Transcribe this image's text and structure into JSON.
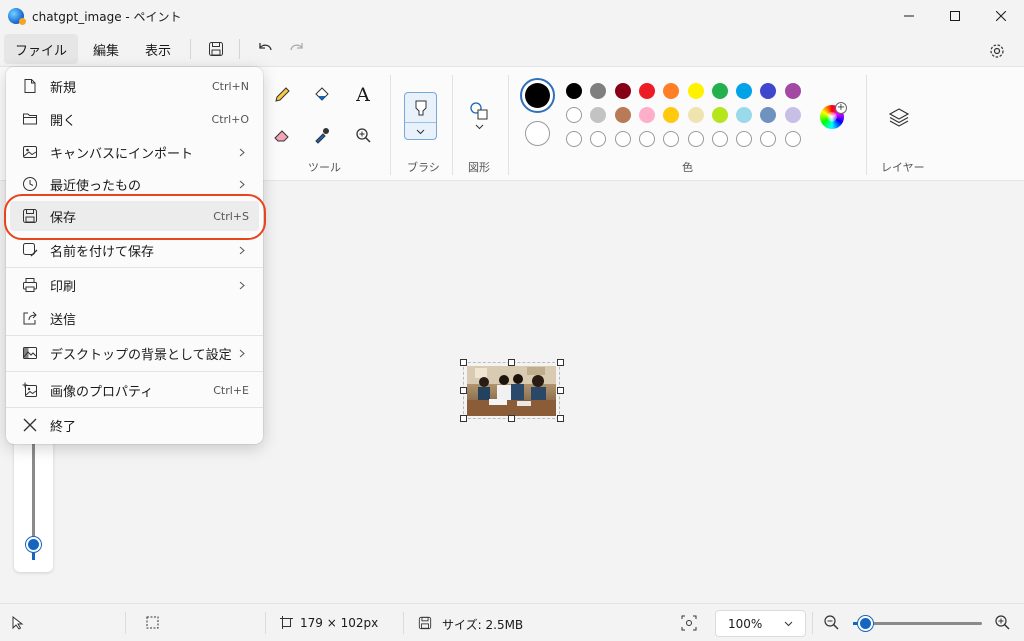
{
  "window": {
    "title": "chatgpt_image - ペイント"
  },
  "menubar": {
    "file": "ファイル",
    "edit": "編集",
    "view": "表示"
  },
  "ribbon": {
    "tools_label": "ツール",
    "brush_label": "ブラシ",
    "shapes_label": "図形",
    "colors_label": "色",
    "layers_label": "レイヤー",
    "text_tool_glyph": "A",
    "colors": {
      "primary": "#000000",
      "secondary": "#ffffff",
      "palette_row1": [
        "#000000",
        "#7f7f7f",
        "#880015",
        "#ed1c24",
        "#ff7f27",
        "#fff200",
        "#22b14c",
        "#00a2e8",
        "#3f48cc",
        "#a349a4"
      ],
      "palette_row2": [
        "#ffffff",
        "#c3c3c3",
        "#b97a57",
        "#ffaec9",
        "#ffc90e",
        "#efe4b0",
        "#b5e61d",
        "#99d9ea",
        "#7092be",
        "#c8bfe7"
      ],
      "palette_row3": [
        "",
        "",
        "",
        "",
        "",
        "",
        "",
        "",
        "",
        ""
      ]
    }
  },
  "file_menu": {
    "items": [
      {
        "label": "新規",
        "shortcut": "Ctrl+N",
        "icon": "new-file-icon"
      },
      {
        "label": "開く",
        "shortcut": "Ctrl+O",
        "icon": "open-folder-icon"
      },
      {
        "label": "キャンバスにインポート",
        "submenu": true,
        "icon": "import-image-icon"
      },
      {
        "label": "最近使ったもの",
        "submenu": true,
        "icon": "recent-clock-icon"
      },
      {
        "label": "保存",
        "shortcut": "Ctrl+S",
        "icon": "save-icon"
      },
      {
        "label": "名前を付けて保存",
        "submenu": true,
        "icon": "save-as-icon"
      },
      {
        "label": "印刷",
        "submenu": true,
        "icon": "print-icon"
      },
      {
        "label": "送信",
        "icon": "share-icon"
      },
      {
        "label": "デスクトップの背景として設定",
        "submenu": true,
        "icon": "desktop-background-icon"
      },
      {
        "label": "画像のプロパティ",
        "shortcut": "Ctrl+E",
        "icon": "image-properties-icon"
      },
      {
        "label": "終了",
        "icon": "close-x-icon"
      }
    ]
  },
  "statusbar": {
    "dimensions": "179 × 102px",
    "size": "サイズ: 2.5MB",
    "zoom": "100%"
  }
}
